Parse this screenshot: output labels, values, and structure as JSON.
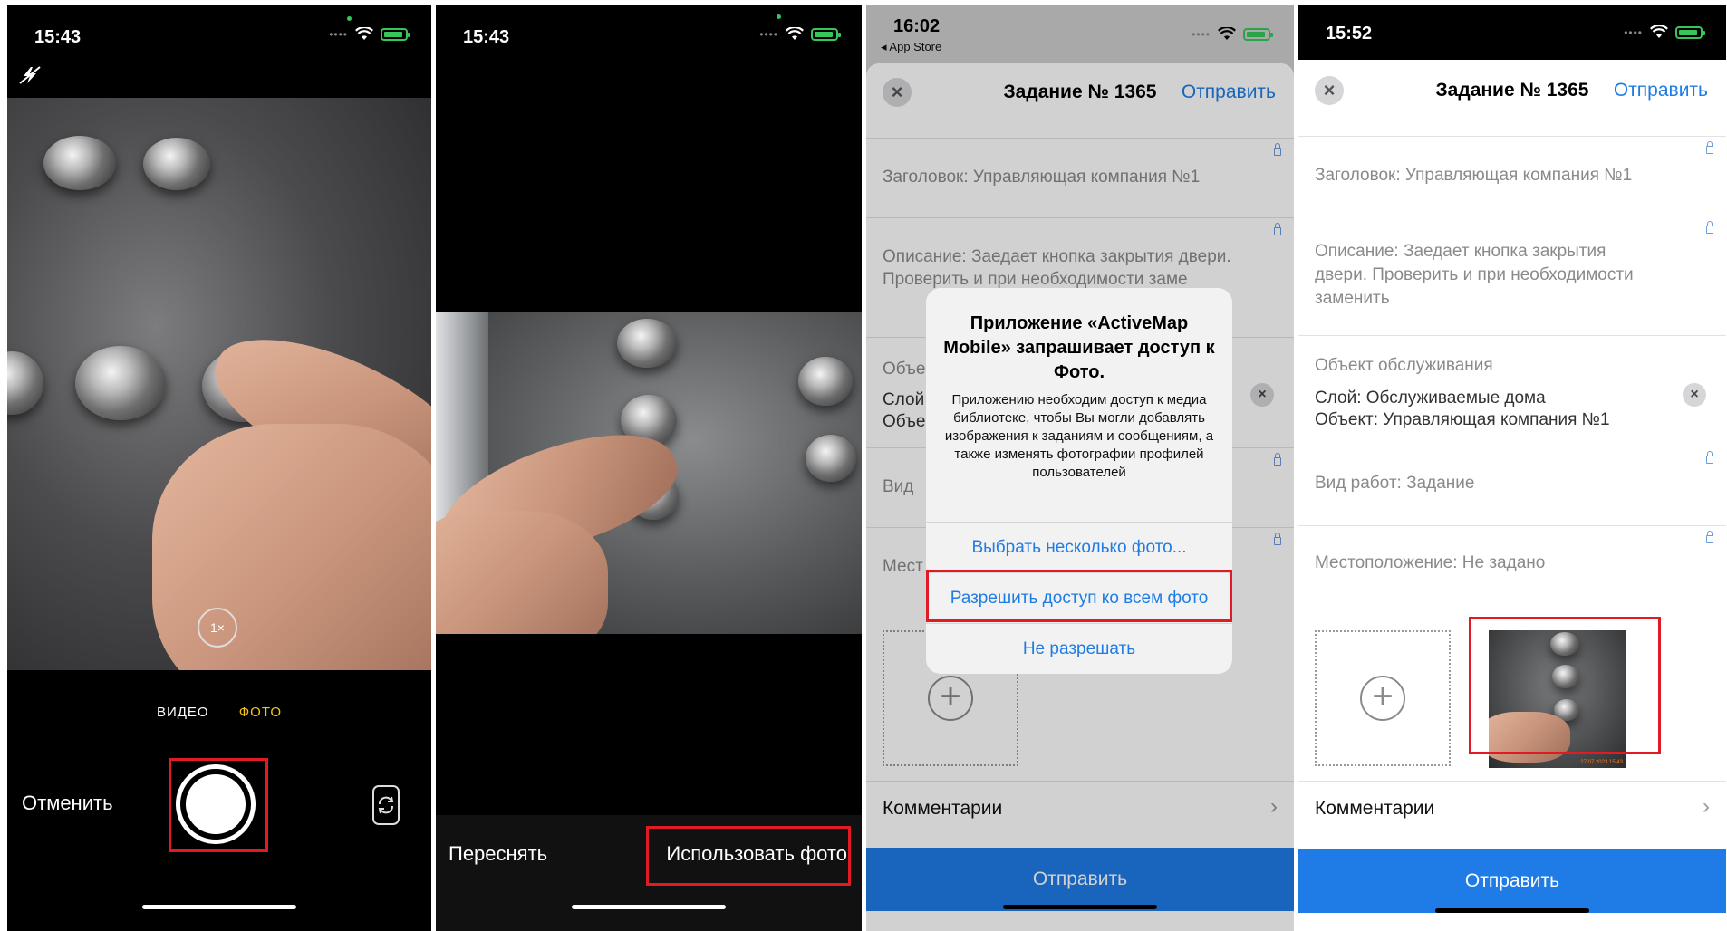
{
  "screens": [
    {
      "status": {
        "time": "15:43"
      },
      "camera": {
        "modes": [
          "ВИДЕО",
          "ФОТО"
        ],
        "cancel": "Отменить",
        "zoom_badge": "1×"
      }
    },
    {
      "status": {
        "time": "15:43"
      },
      "review": {
        "retake": "Переснять",
        "use_photo": "Использовать фото"
      }
    },
    {
      "status": {
        "time": "16:02",
        "back_label": "◂ App Store"
      },
      "task": {
        "title": "Задание № 1365",
        "send_link": "Отправить",
        "header_field": "Заголовок: Управляющая компания №1",
        "description": "Описание: Заедает кнопка закрытия двери. Проверить и при необходимости заме",
        "object_label": "Объе",
        "object_value_1": "Слой",
        "object_value_2": "Объе",
        "work_type": "Вид",
        "location": "Мест",
        "comments": "Комментарии",
        "send_button": "Отправить"
      },
      "dialog": {
        "title": "Приложение «ActiveMap Mobile» запрашивает доступ к Фото.",
        "message": "Приложению необходим доступ к медиа библиотеке, чтобы Вы могли добавлять изображения к заданиям и сообщениям, а также изменять фотографии профилей пользователей",
        "buttons": [
          "Выбрать несколько фото...",
          "Разрешить доступ ко всем фото",
          "Не разрешать"
        ]
      }
    },
    {
      "status": {
        "time": "15:52"
      },
      "task": {
        "title": "Задание № 1365",
        "send_link": "Отправить",
        "header_field": "Заголовок: Управляющая компания №1",
        "description_1": "Описание: Заедает кнопка закрытия",
        "description_2": "двери. Проверить и при необходимости",
        "description_3": "заменить",
        "object_label": "Объект обслуживания",
        "object_value_1": "Слой: Обслуживаемые дома",
        "object_value_2": "Объект: Управляющая компания №1",
        "work_type": "Вид работ: Задание",
        "location": "Местоположение: Не задано",
        "photo_stamp": "27.07.2023 15:43",
        "comments": "Комментарии",
        "send_button": "Отправить"
      }
    }
  ],
  "colors": {
    "accent": "#1e7ce6",
    "highlight": "#e01b24",
    "camera_mode_active": "#f5c518"
  }
}
